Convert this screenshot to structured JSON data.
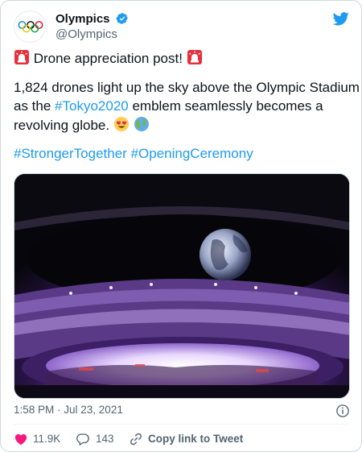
{
  "account": {
    "display_name": "Olympics",
    "handle": "@Olympics"
  },
  "tweet": {
    "line1": "Drone appreciation post!",
    "para2_line1": "1,824 drones light up the sky above the Olympic Stadium",
    "para2_line2_pre": "as the ",
    "para2_hashtag": "#Tokyo2020",
    "para2_line2_post": " emblem seamlessly becomes a",
    "para2_line3": "revolving globe.",
    "hashtag1": "#StrongerTogether",
    "hashtag2": "#OpeningCeremony"
  },
  "meta": {
    "timestamp": "1:58 PM · Jul 23, 2021"
  },
  "actions": {
    "likes": "11.9K",
    "replies": "143",
    "copy_link": "Copy link to Tweet"
  },
  "colors": {
    "accent": "#1d9bf0",
    "like_red": "#f91880",
    "muted": "#536471"
  },
  "icons": [
    "olympic-rings-icon",
    "verified-badge-icon",
    "twitter-bird-icon",
    "rotating-light-icon",
    "heart-eyes-emoji-icon",
    "globe-emoji-icon",
    "info-icon",
    "heart-icon",
    "reply-icon",
    "link-icon"
  ]
}
